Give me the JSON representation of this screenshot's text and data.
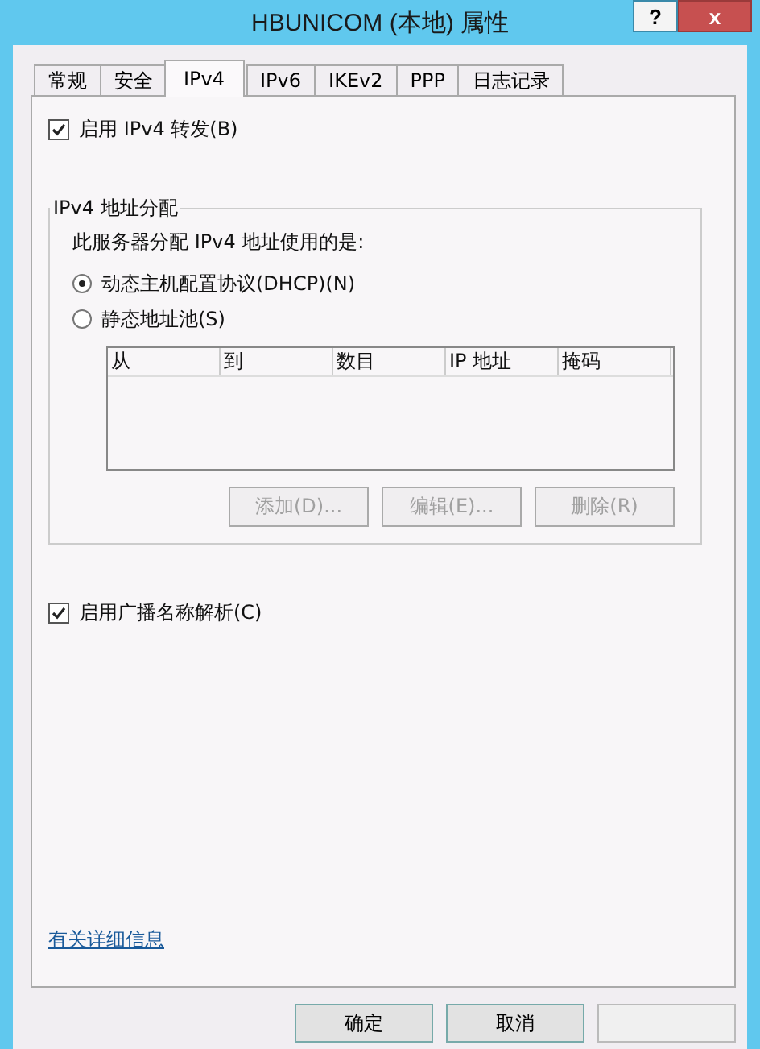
{
  "window": {
    "title": "HBUNICOM (本地) 属性",
    "help": "?",
    "close": "x"
  },
  "tabs": [
    {
      "label": "常规",
      "selected": false
    },
    {
      "label": "安全",
      "selected": false
    },
    {
      "label": "IPv4",
      "selected": true
    },
    {
      "label": "IPv6",
      "selected": false
    },
    {
      "label": "IKEv2",
      "selected": false
    },
    {
      "label": "PPP",
      "selected": false
    },
    {
      "label": "日志记录",
      "selected": false
    }
  ],
  "forwarding": {
    "label": "启用 IPv4 转发(B)",
    "checked": true
  },
  "assignment": {
    "legend": "IPv4 地址分配",
    "prompt": "此服务器分配 IPv4 地址使用的是:",
    "options": [
      {
        "label": "动态主机配置协议(DHCP)(N)",
        "selected": true
      },
      {
        "label": "静态地址池(S)",
        "selected": false
      }
    ],
    "columns": [
      "从",
      "到",
      "数目",
      "IP 地址",
      "掩码"
    ],
    "buttons": [
      {
        "label": "添加(D)...",
        "disabled": true
      },
      {
        "label": "编辑(E)...",
        "disabled": true
      },
      {
        "label": "删除(R)",
        "disabled": true
      }
    ]
  },
  "broadcast": {
    "label": "启用广播名称解析(C)",
    "checked": true
  },
  "link": "有关详细信息",
  "footer_buttons": [
    {
      "label": "确定",
      "disabled": false
    },
    {
      "label": "取消",
      "disabled": false
    },
    {
      "disabled": true
    }
  ]
}
